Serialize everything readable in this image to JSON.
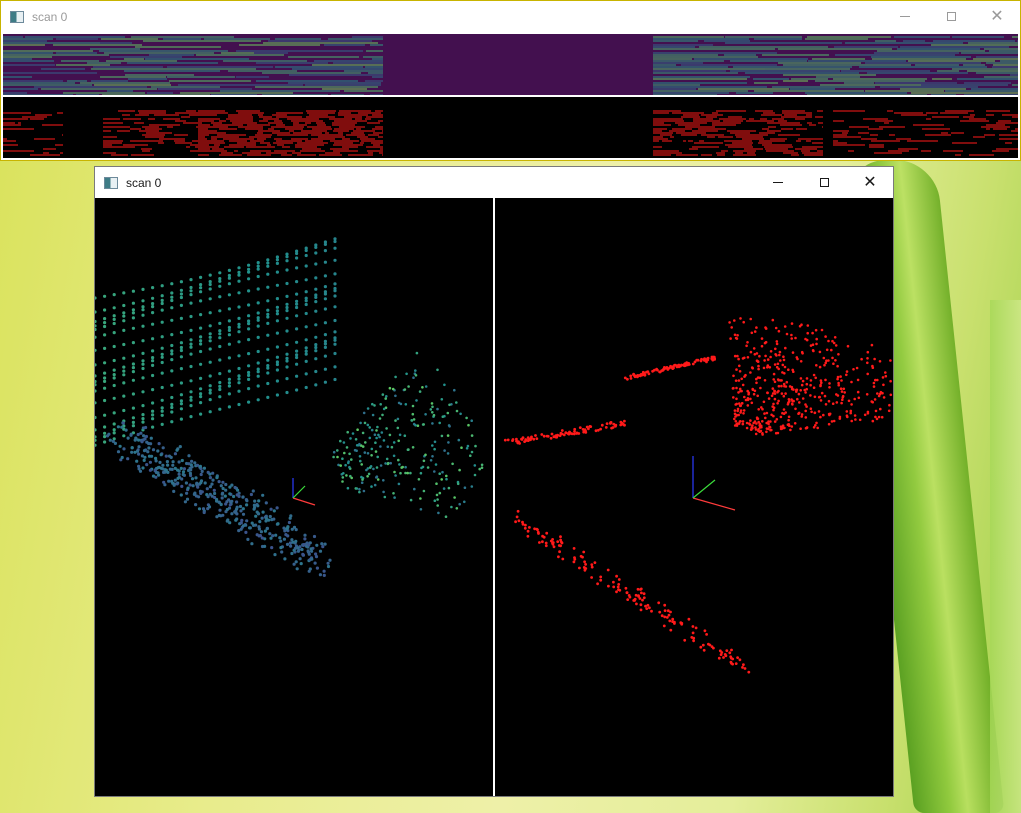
{
  "windows": {
    "top": {
      "title": "scan 0"
    },
    "main": {
      "title": "scan 0"
    }
  },
  "icons": {
    "app": "app-window-icon",
    "minimize": "minimize-icon",
    "maximize": "maximize-icon",
    "close": "close-icon"
  },
  "colors": {
    "range_background": "#43104f",
    "label_points": "#ff1a1a",
    "axis_x": "#ff3b3b",
    "axis_y": "#3bdc3b",
    "axis_z": "#2b3bff"
  },
  "controls": {
    "close_glyph": "✕"
  }
}
